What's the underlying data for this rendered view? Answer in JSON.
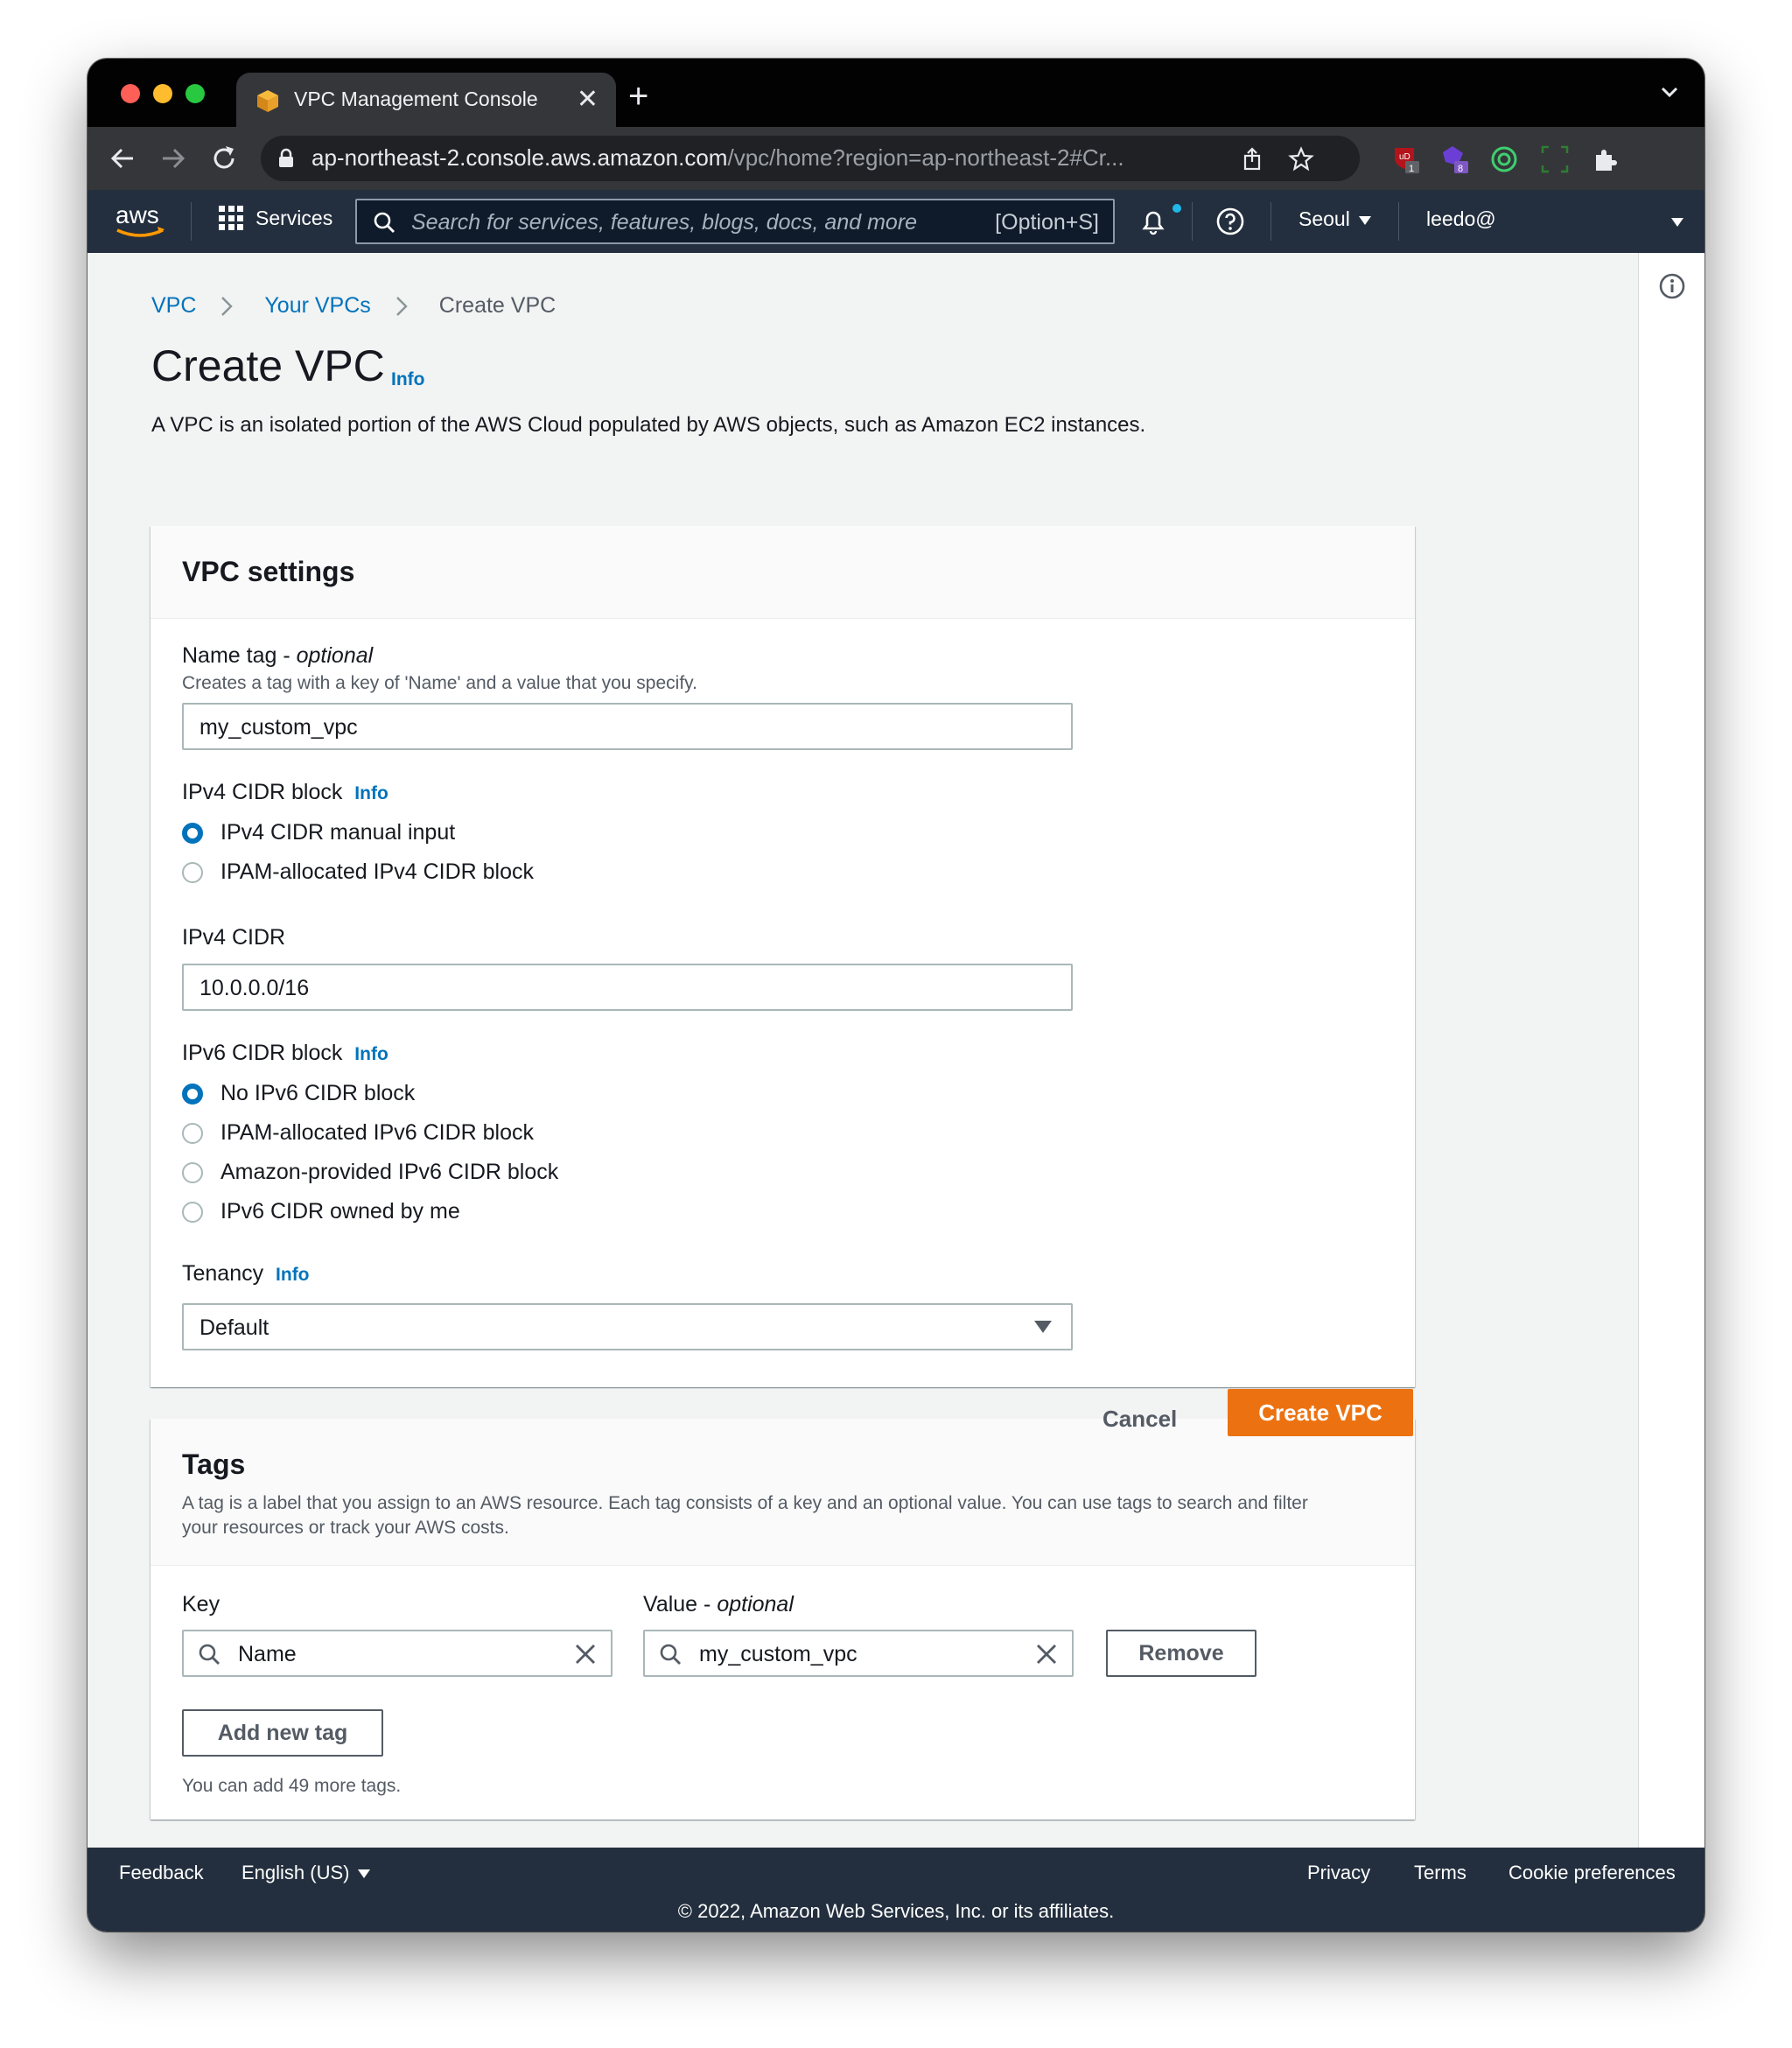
{
  "browser": {
    "tab_title": "VPC Management Console",
    "url_host": "ap-northeast-2.console.aws.amazon.com",
    "url_path": "/vpc/home?region=ap-northeast-2#Cr...",
    "extension_badges": [
      "1",
      "8"
    ]
  },
  "aws_nav": {
    "services_label": "Services",
    "search_placeholder": "Search for services, features, blogs, docs, and more",
    "search_shortcut": "[Option+S]",
    "region": "Seoul",
    "user": "leedo@"
  },
  "breadcrumb": {
    "items": [
      "VPC",
      "Your VPCs",
      "Create VPC"
    ]
  },
  "page": {
    "title": "Create VPC",
    "info_label": "Info",
    "description": "A VPC is an isolated portion of the AWS Cloud populated by AWS objects, such as Amazon EC2 instances."
  },
  "vpc_settings": {
    "title": "VPC settings",
    "name_tag": {
      "label": "Name tag - ",
      "label_optional": "optional",
      "description": "Creates a tag with a key of 'Name' and a value that you specify.",
      "value": "my_custom_vpc"
    },
    "ipv4_block": {
      "label": "IPv4 CIDR block",
      "info": "Info",
      "options": [
        "IPv4 CIDR manual input",
        "IPAM-allocated IPv4 CIDR block"
      ],
      "selected": "IPv4 CIDR manual input"
    },
    "ipv4_cidr": {
      "label": "IPv4 CIDR",
      "value": "10.0.0.0/16"
    },
    "ipv6_block": {
      "label": "IPv6 CIDR block",
      "info": "Info",
      "options": [
        "No IPv6 CIDR block",
        "IPAM-allocated IPv6 CIDR block",
        "Amazon-provided IPv6 CIDR block",
        "IPv6 CIDR owned by me"
      ],
      "selected": "No IPv6 CIDR block"
    },
    "tenancy": {
      "label": "Tenancy",
      "info": "Info",
      "value": "Default"
    }
  },
  "tags": {
    "title": "Tags",
    "description_line1": "A tag is a label that you assign to an AWS resource. Each tag consists of a key and an optional value. You can use tags to search and filter",
    "description_line2": "your resources or track your AWS costs.",
    "key_label": "Key",
    "value_label": "Value - ",
    "value_label_optional": "optional",
    "rows": [
      {
        "key": "Name",
        "value": "my_custom_vpc"
      }
    ],
    "remove_label": "Remove",
    "add_label": "Add new tag",
    "hint": "You can add 49 more tags."
  },
  "actions": {
    "cancel": "Cancel",
    "create": "Create VPC"
  },
  "footer": {
    "feedback": "Feedback",
    "language": "English (US)",
    "privacy": "Privacy",
    "terms": "Terms",
    "cookies": "Cookie preferences",
    "copyright": "© 2022, Amazon Web Services, Inc. or its affiliates."
  },
  "colors": {
    "aws_nav": "#232f3e",
    "link": "#0073bb",
    "primary_button": "#ec7211"
  }
}
